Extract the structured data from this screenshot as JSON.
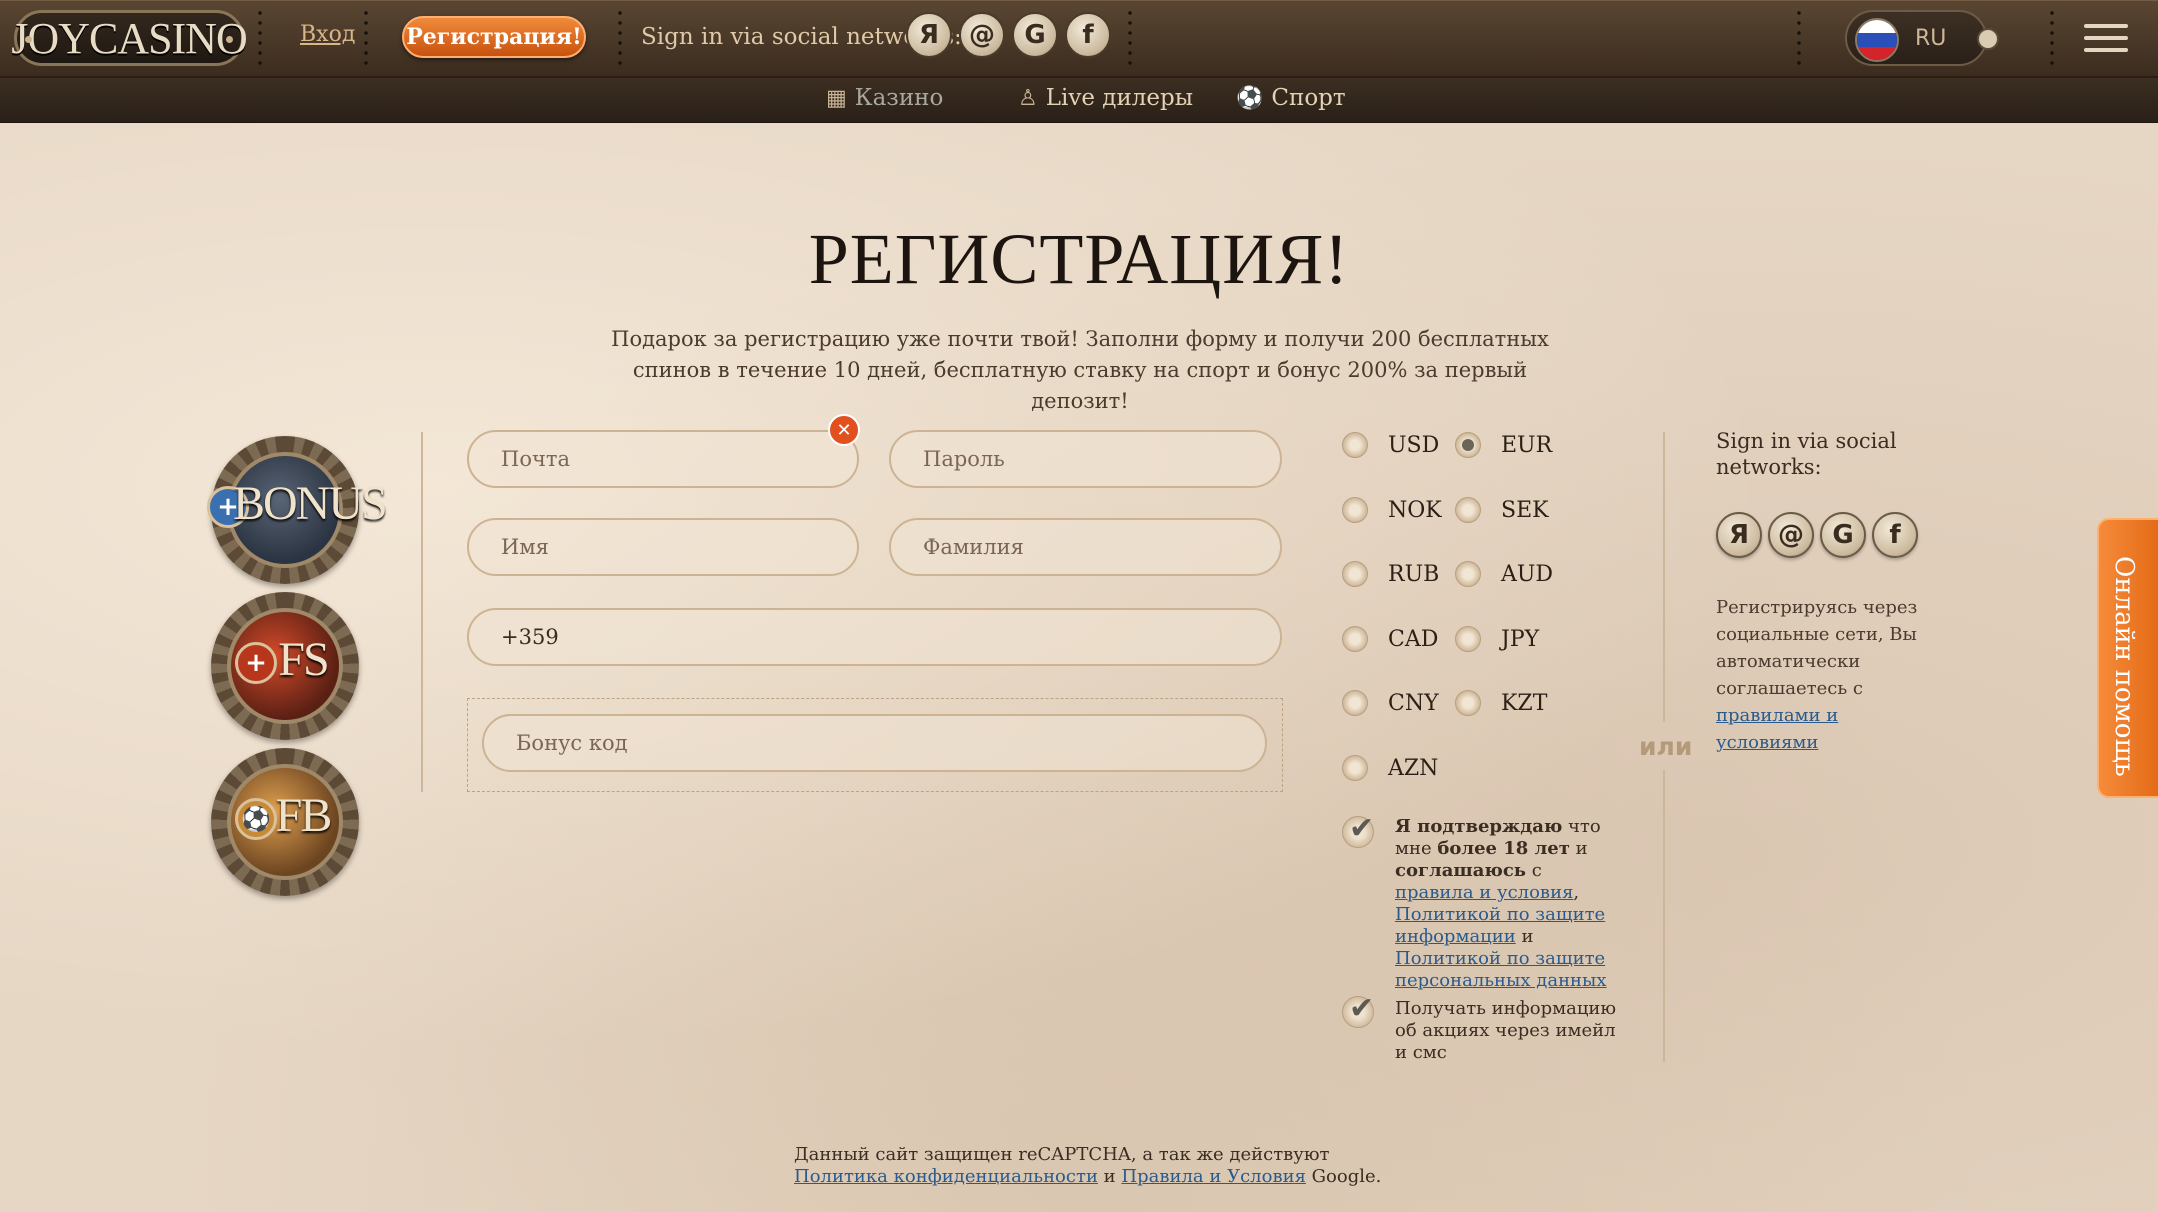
{
  "header": {
    "logo": "JOYCASINO",
    "login": "Вход",
    "register": "Регистрация!",
    "social_title": "Sign in via social networks:",
    "social": [
      {
        "icon": "yandex-icon",
        "glyph": "Я"
      },
      {
        "icon": "mail-icon",
        "glyph": "@"
      },
      {
        "icon": "google-icon",
        "glyph": "G"
      },
      {
        "icon": "facebook-icon",
        "glyph": "f"
      }
    ],
    "lang": "RU"
  },
  "subnav": [
    {
      "label": "Казино",
      "icon": "slot-machine-icon",
      "active": true
    },
    {
      "label": "Live дилеры",
      "icon": "dealer-icon",
      "active": false
    },
    {
      "label": "Спорт",
      "icon": "soccer-ball-icon",
      "active": false
    }
  ],
  "page": {
    "title": "РЕГИСТРАЦИЯ!",
    "subtitle": "Подарок за регистрацию уже почти твой! Заполни форму и получи 200 бесплатных спинов в течение 10 дней, бесплатную ставку на спорт и бонус 200% за первый депозит!"
  },
  "badges": [
    "BONUS",
    "FS",
    "FB"
  ],
  "form": {
    "email_placeholder": "Почта",
    "password_placeholder": "Пароль",
    "first_name_placeholder": "Имя",
    "last_name_placeholder": "Фамилия",
    "phone_value": "+359",
    "bonus_placeholder": "Бонус код"
  },
  "currencies": {
    "selected": "EUR",
    "items": [
      "USD",
      "EUR",
      "NOK",
      "SEK",
      "RUB",
      "AUD",
      "CAD",
      "JPY",
      "CNY",
      "KZT",
      "AZN"
    ]
  },
  "or_label": "или",
  "agree": {
    "checked": true,
    "b1": "Я подтверждаю",
    "t1": " что мне ",
    "b2": "более 18 лет",
    "t2": " и ",
    "b3": "соглашаюсь",
    "t3": " с ",
    "link1": "правила и условия",
    "t4": ", ",
    "link2": "Политикой по защите информации",
    "t5": " и ",
    "link3": "Политикой по защите персональных данных"
  },
  "promo": {
    "checked": true,
    "text": "Получать информацию об акциях через имейл и смс"
  },
  "side": {
    "title": "Sign in via social networks:",
    "note": "Регистрируясь через социальные сети, Вы автоматически соглашаетесь с ",
    "link": "правилами и условиями"
  },
  "help_tab": "Онлайн помощь",
  "footer": {
    "t1": "Данный сайт защищен reCAPTCHA, а так же действуют ",
    "link1": "Политика конфиденциальности",
    "t2": " и ",
    "link2": "Правила и Условия",
    "t3": " Google."
  },
  "colors": {
    "accent": "#e4661b",
    "link": "#2a5a8c",
    "header": "#3b2c1f"
  }
}
